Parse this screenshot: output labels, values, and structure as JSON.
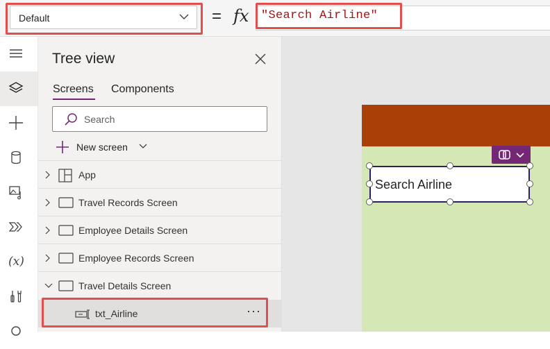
{
  "formula_bar": {
    "property": "Default",
    "equals": "=",
    "fx": "fx",
    "formula": "\"Search Airline\""
  },
  "rail": {
    "icons": [
      "menu-icon",
      "layers-icon",
      "add-icon",
      "data-icon",
      "media-icon",
      "power-automate-icon",
      "variables-icon",
      "tools-icon",
      "search-icon"
    ],
    "variables_label": "(x)"
  },
  "tree_view": {
    "title": "Tree view",
    "tabs": [
      "Screens",
      "Components"
    ],
    "search_placeholder": "Search",
    "new_screen_label": "New screen",
    "items": [
      {
        "label": "App",
        "icon": "app-icon"
      },
      {
        "label": "Travel Records Screen",
        "icon": "screen-icon"
      },
      {
        "label": "Employee Details Screen",
        "icon": "screen-icon"
      },
      {
        "label": "Employee Records Screen",
        "icon": "screen-icon"
      },
      {
        "label": "Travel Details Screen",
        "icon": "screen-icon",
        "expanded": true
      }
    ],
    "selected_child": {
      "label": "txt_Airline",
      "icon": "text-input-icon",
      "more": "···"
    }
  },
  "canvas": {
    "textbox_text": "Search Airline",
    "colors": {
      "header": "#a84008",
      "screen_bg": "#d4e7b5",
      "accent": "#742774",
      "highlight": "#e24d4d"
    }
  }
}
